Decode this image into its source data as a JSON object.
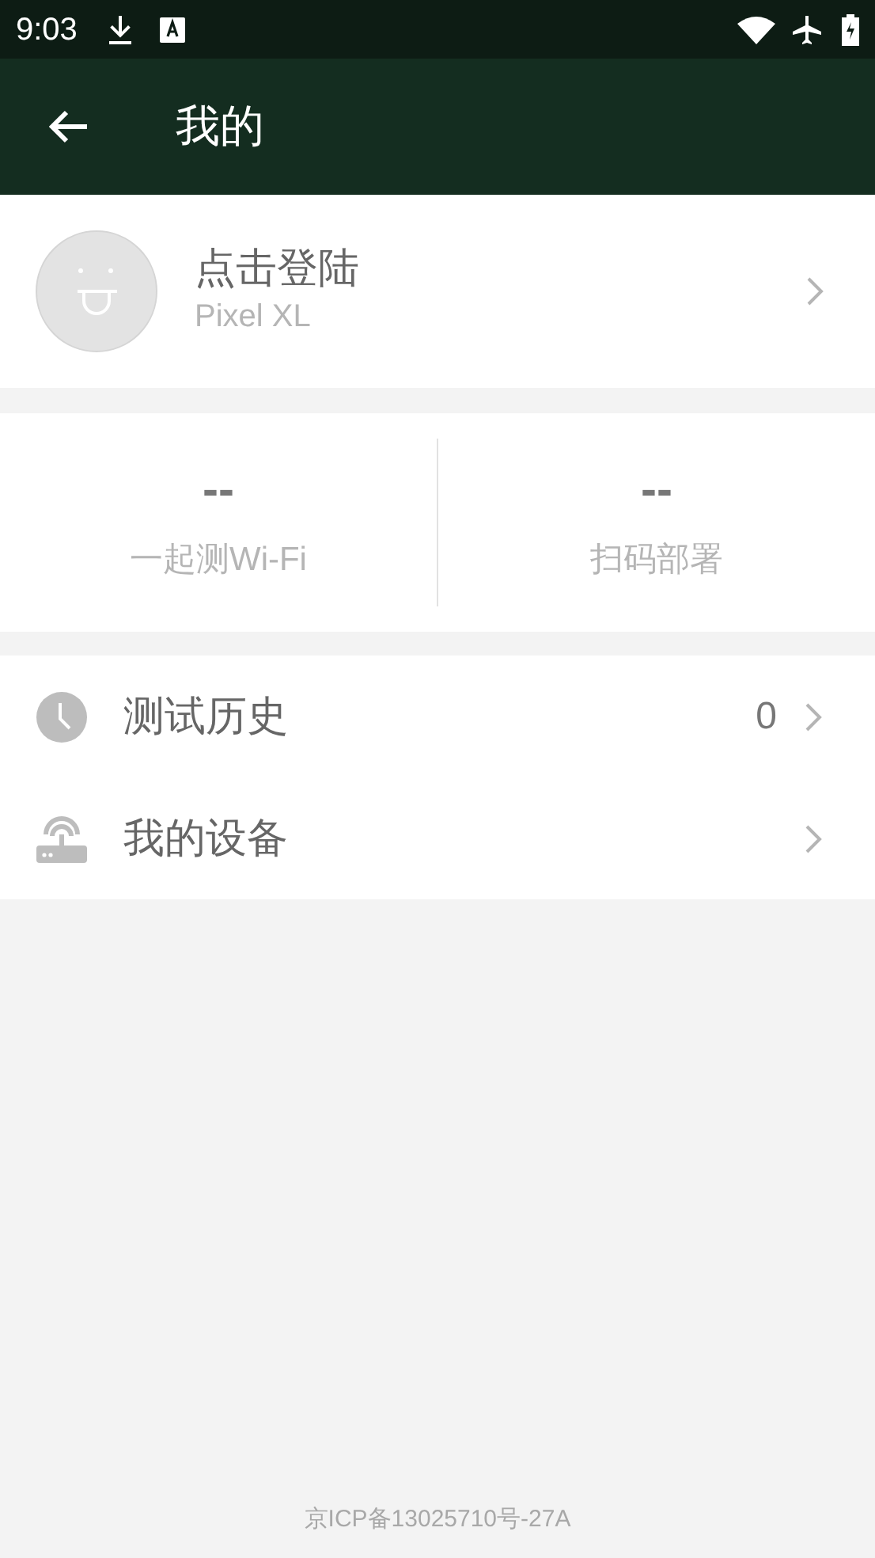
{
  "status_bar": {
    "time": "9:03"
  },
  "app_bar": {
    "title": "我的"
  },
  "profile": {
    "name": "点击登陆",
    "subtitle": "Pixel XL"
  },
  "stats": [
    {
      "value": "--",
      "label": "一起测Wi-Fi"
    },
    {
      "value": "--",
      "label": "扫码部署"
    }
  ],
  "menu": [
    {
      "label": "测试历史",
      "count": "0"
    },
    {
      "label": "我的设备"
    }
  ],
  "footer": "京ICP备13025710号-27A"
}
